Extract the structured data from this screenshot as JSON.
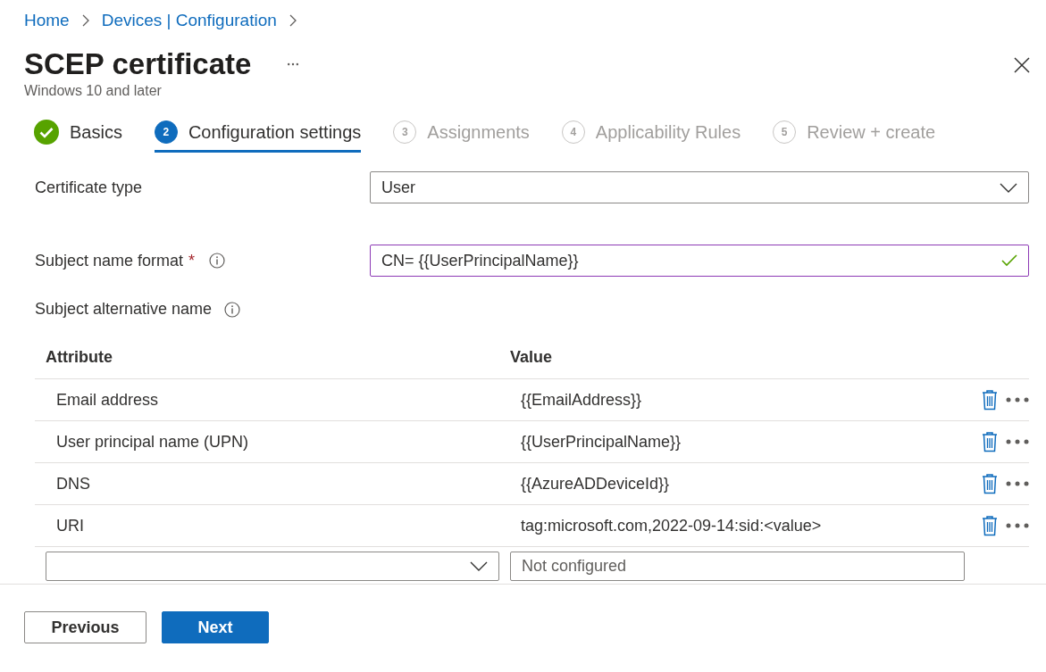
{
  "breadcrumb": [
    {
      "label": "Home"
    },
    {
      "label": "Devices | Configuration"
    }
  ],
  "header": {
    "title": "SCEP certificate",
    "subtitle": "Windows 10 and later"
  },
  "steps": [
    {
      "label": "Basics",
      "kind": "completed",
      "selected": false
    },
    {
      "number": "2",
      "label": "Configuration settings",
      "kind": "current",
      "selected": true
    },
    {
      "number": "3",
      "label": "Assignments",
      "kind": "pending",
      "selected": false
    },
    {
      "number": "4",
      "label": "Applicability Rules",
      "kind": "pending",
      "selected": false
    },
    {
      "number": "5",
      "label": "Review + create",
      "kind": "pending",
      "selected": false
    }
  ],
  "form": [
    {
      "kind": "dropdown",
      "label": "Certificate type",
      "info": false,
      "value": "User"
    },
    {
      "kind": "text",
      "label": "Subject name format",
      "required_mark": "*",
      "info": true,
      "value": "CN= {{UserPrincipalName}}",
      "valid": true
    }
  ],
  "san": {
    "label": "Subject alternative name",
    "info": true,
    "columns": [
      "Attribute",
      "Value"
    ],
    "rows": [
      {
        "attribute": "Email address",
        "value": "{{EmailAddress}}"
      },
      {
        "attribute": "User principal name (UPN)",
        "value": "{{UserPrincipalName}}"
      },
      {
        "attribute": "DNS",
        "value": "{{AzureADDeviceId}}"
      },
      {
        "attribute": "URI",
        "value": "tag:microsoft.com,2022-09-14:sid:<value>"
      }
    ],
    "new_row": {
      "value_placeholder": "Not configured"
    }
  },
  "buttons": [
    {
      "label": "Previous",
      "kind": "secondary"
    },
    {
      "label": "Next",
      "kind": "primary"
    }
  ]
}
